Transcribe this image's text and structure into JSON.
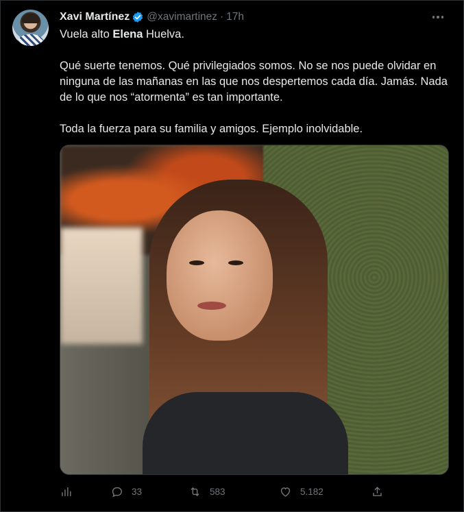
{
  "author": {
    "name": "Xavi Martínez",
    "handle": "@xavimartinez",
    "separator": "·",
    "time": "17h",
    "verified": true
  },
  "tweet": {
    "p1_pre": "Vuela alto ",
    "p1_bold": "Elena",
    "p1_post": " Huelva.",
    "p2": "Qué suerte tenemos. Qué privilegiados somos. No se nos puede olvidar en ninguna de las mañanas en las que nos despertemos cada día. Jamás. Nada de lo que nos “atormenta” es tan importante.",
    "p3": "Toda la fuerza para su familia y amigos. Ejemplo inolvidable."
  },
  "actions": {
    "replies": "33",
    "retweets": "583",
    "likes": "5.182"
  },
  "icons": {
    "verified": "verified-badge-icon",
    "more": "more-options-icon",
    "analytics": "analytics-icon",
    "reply": "reply-icon",
    "retweet": "retweet-icon",
    "like": "heart-icon",
    "share": "share-icon"
  },
  "colors": {
    "background": "#000000",
    "text": "#e7e9ea",
    "muted": "#71767b",
    "verified": "#1d9bf0"
  }
}
